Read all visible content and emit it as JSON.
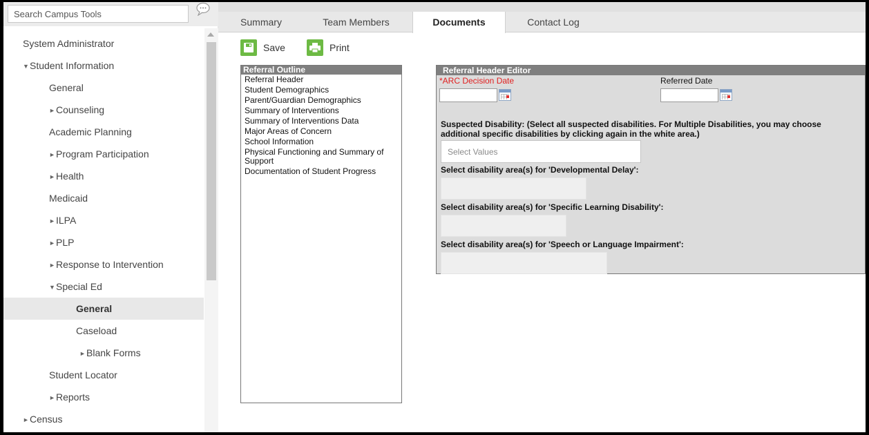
{
  "sidebar": {
    "search_placeholder": "Search Campus Tools",
    "chat_icon": "chat-bubble-icon",
    "items": [
      {
        "label": "System Administrator",
        "level": 0,
        "tri": ""
      },
      {
        "label": "Student Information",
        "level": 0,
        "tri": "▼"
      },
      {
        "label": "General",
        "level": 1,
        "tri": ""
      },
      {
        "label": "Counseling",
        "level": 1,
        "tri": "►"
      },
      {
        "label": "Academic Planning",
        "level": 1,
        "tri": ""
      },
      {
        "label": "Program Participation",
        "level": 1,
        "tri": "►"
      },
      {
        "label": "Health",
        "level": 1,
        "tri": "►"
      },
      {
        "label": "Medicaid",
        "level": 1,
        "tri": ""
      },
      {
        "label": "ILPA",
        "level": 1,
        "tri": "►"
      },
      {
        "label": "PLP",
        "level": 1,
        "tri": "►"
      },
      {
        "label": "Response to Intervention",
        "level": 1,
        "tri": "►"
      },
      {
        "label": "Special Ed",
        "level": 1,
        "tri": "▼"
      },
      {
        "label": "General",
        "level": 2,
        "tri": "",
        "active": true
      },
      {
        "label": "Caseload",
        "level": 2,
        "tri": ""
      },
      {
        "label": "Blank Forms",
        "level": 3,
        "tri": "►"
      },
      {
        "label": "Student Locator",
        "level": 1,
        "tri": ""
      },
      {
        "label": "Reports",
        "level": 1,
        "tri": "►"
      },
      {
        "label": "Census",
        "level": 0,
        "tri": "►"
      }
    ]
  },
  "tabs": [
    {
      "label": "Summary",
      "active": false
    },
    {
      "label": "Team Members",
      "active": false
    },
    {
      "label": "Documents",
      "active": true
    },
    {
      "label": "Contact Log",
      "active": false
    }
  ],
  "toolbar": {
    "save_label": "Save",
    "print_label": "Print",
    "accent": "#6dba44"
  },
  "outline": {
    "title": "Referral Outline",
    "items": [
      "Referral Header",
      "Student Demographics",
      "Parent/Guardian Demographics",
      "Summary of Interventions",
      "Summary of Interventions Data",
      "Major Areas of Concern",
      "School Information",
      "Physical Functioning and Summary of Support",
      "Documentation of Student Progress"
    ]
  },
  "editor": {
    "title": "Referral Header Editor",
    "arc_label": "*ARC Decision Date",
    "arc_value": "",
    "referred_label": "Referred Date",
    "referred_value": "",
    "suspected_text": "Suspected Disability: (Select all suspected disabilities. For Multiple Disabilities, you may choose additional specific disabilities by clicking again in the white area.)",
    "select_placeholder": "Select Values",
    "dd_label": "Select disability area(s) for 'Developmental Delay':",
    "sld_label": "Select disability area(s) for 'Specific Learning Disability':",
    "sli_label": "Select disability area(s) for 'Speech or Language Impairment':",
    "required_color": "#e02020"
  }
}
